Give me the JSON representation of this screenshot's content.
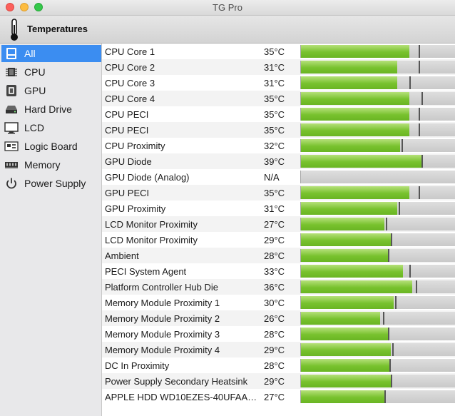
{
  "window": {
    "title": "TG Pro"
  },
  "toolbar": {
    "title": "Temperatures",
    "icon": "thermometer-icon"
  },
  "sidebar": {
    "items": [
      {
        "label": "All",
        "icon": "all-icon",
        "selected": true
      },
      {
        "label": "CPU",
        "icon": "cpu-chip-icon"
      },
      {
        "label": "GPU",
        "icon": "gpu-chip-icon"
      },
      {
        "label": "Hard Drive",
        "icon": "hard-drive-icon"
      },
      {
        "label": "LCD",
        "icon": "lcd-monitor-icon"
      },
      {
        "label": "Logic Board",
        "icon": "logic-board-icon"
      },
      {
        "label": "Memory",
        "icon": "memory-icon"
      },
      {
        "label": "Power Supply",
        "icon": "power-icon"
      }
    ]
  },
  "colors": {
    "accent": "#3b8df1",
    "bar_fill": "#78c22e",
    "bar_track": "#d4d4d4"
  },
  "sensors": [
    {
      "name": "CPU Core 1",
      "temp": "35°C",
      "level": 0.7,
      "max": 0.76
    },
    {
      "name": "CPU Core 2",
      "temp": "31°C",
      "level": 0.62,
      "max": 0.76
    },
    {
      "name": "CPU Core 3",
      "temp": "31°C",
      "level": 0.62,
      "max": 0.7
    },
    {
      "name": "CPU Core 4",
      "temp": "35°C",
      "level": 0.7,
      "max": 0.78
    },
    {
      "name": "CPU PECI",
      "temp": "35°C",
      "level": 0.7,
      "max": 0.76
    },
    {
      "name": "CPU PECI",
      "temp": "35°C",
      "level": 0.7,
      "max": 0.76
    },
    {
      "name": "CPU Proximity",
      "temp": "32°C",
      "level": 0.64,
      "max": 0.65
    },
    {
      "name": "GPU Diode",
      "temp": "39°C",
      "level": 0.78,
      "max": 0.78
    },
    {
      "name": "GPU Diode (Analog)",
      "temp": "N/A",
      "level": 0.0,
      "max": 0.0
    },
    {
      "name": "GPU PECI",
      "temp": "35°C",
      "level": 0.7,
      "max": 0.76
    },
    {
      "name": "GPU Proximity",
      "temp": "31°C",
      "level": 0.62,
      "max": 0.63
    },
    {
      "name": "LCD Monitor Proximity",
      "temp": "27°C",
      "level": 0.54,
      "max": 0.55
    },
    {
      "name": "LCD Monitor Proximity",
      "temp": "29°C",
      "level": 0.58,
      "max": 0.58
    },
    {
      "name": "Ambient",
      "temp": "28°C",
      "level": 0.56,
      "max": 0.56
    },
    {
      "name": "PECI System Agent",
      "temp": "33°C",
      "level": 0.66,
      "max": 0.7
    },
    {
      "name": "Platform Controller Hub Die",
      "temp": "36°C",
      "level": 0.72,
      "max": 0.74
    },
    {
      "name": "Memory Module Proximity 1",
      "temp": "30°C",
      "level": 0.6,
      "max": 0.61
    },
    {
      "name": "Memory Module Proximity 2",
      "temp": "26°C",
      "level": 0.51,
      "max": 0.53
    },
    {
      "name": "Memory Module Proximity 3",
      "temp": "28°C",
      "level": 0.56,
      "max": 0.56
    },
    {
      "name": "Memory Module Proximity 4",
      "temp": "29°C",
      "level": 0.58,
      "max": 0.59
    },
    {
      "name": "DC In Proximity",
      "temp": "28°C",
      "level": 0.57,
      "max": 0.57
    },
    {
      "name": "Power Supply Secondary Heatsink",
      "temp": "29°C",
      "level": 0.58,
      "max": 0.58
    },
    {
      "name": "APPLE HDD WD10EZES-40UFAA…",
      "temp": "27°C",
      "level": 0.54,
      "max": 0.54
    }
  ]
}
